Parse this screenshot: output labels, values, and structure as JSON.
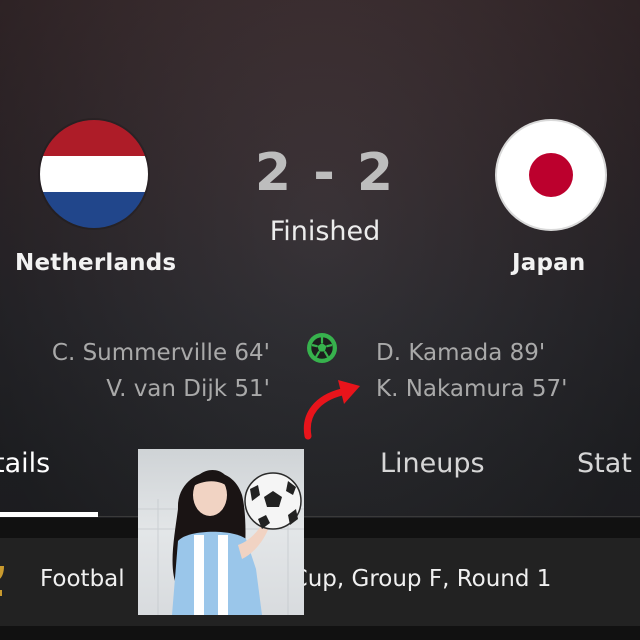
{
  "match": {
    "home": {
      "name": "Netherlands",
      "flag_colors": [
        "#ae1c28",
        "#ffffff",
        "#21468b"
      ]
    },
    "away": {
      "name": "Japan",
      "flag_colors": [
        "#ffffff",
        "#bc002d"
      ]
    },
    "score": "2 - 2",
    "status": "Finished",
    "home_scorers": [
      "C. Summerville 64'",
      "V. van Dijk 51'"
    ],
    "away_scorers": [
      "D. Kamada 89'",
      "K. Nakamura 57'"
    ],
    "goal_icon": "soccer-ball-icon",
    "goal_icon_color": "#37b24d",
    "arrow_icon": "curved-arrow-icon",
    "arrow_color": "#e8141b"
  },
  "tabs": {
    "details": "tails",
    "lineups": "Lineups",
    "stats": "Stat"
  },
  "league": {
    "text_left": "Footbal",
    "text_right": "Cup, Group F, Round 1",
    "icon": "trophy-icon"
  },
  "overlay": {
    "type": "photo",
    "description_icon": "person-with-soccer-ball-photo"
  }
}
